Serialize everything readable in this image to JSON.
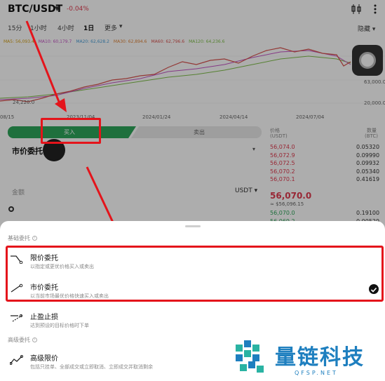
{
  "header": {
    "pair": "BTC/USDT",
    "change": "-0.04%",
    "icons": [
      "candlestick-icon",
      "more-icon"
    ]
  },
  "intervals": {
    "items": [
      "15分",
      "1小时",
      "4小时",
      "1日",
      "更多"
    ],
    "active": "1日",
    "hide_label": "隐藏"
  },
  "ma_indicators": [
    {
      "label": "MA5: 56,093.4",
      "color": "#d4a017"
    },
    {
      "label": "MA10: 60,179.7",
      "color": "#c455c4"
    },
    {
      "label": "MA20: 62,628.2",
      "color": "#4a9fd8"
    },
    {
      "label": "MA30: 62,894.6",
      "color": "#e0853a"
    },
    {
      "label": "MA60: 62,796.6",
      "color": "#d9534f"
    },
    {
      "label": "MA120: 64,236.6",
      "color": "#7fbf4a"
    }
  ],
  "chart": {
    "price_high": "63,000.0",
    "price_low": "20,000.0",
    "min_label": "24,220.0",
    "x_labels": [
      "08/15",
      "2023/11/04",
      "2024/01/24",
      "2024/04/14",
      "2024/07/04"
    ]
  },
  "trade_tabs": {
    "buy": "买入",
    "sell": "卖出"
  },
  "order_form": {
    "order_type": "市价委托",
    "amount_label": "金额",
    "amount_unit": "USDT"
  },
  "order_book": {
    "price_header": "价格",
    "price_unit": "(USDT)",
    "qty_header": "数量",
    "qty_unit": "(BTC)",
    "asks": [
      {
        "price": "56,074.0",
        "qty": "0.05320"
      },
      {
        "price": "56,072.9",
        "qty": "0.09990"
      },
      {
        "price": "56,072.5",
        "qty": "0.09932"
      },
      {
        "price": "56,070.2",
        "qty": "0.05340"
      },
      {
        "price": "56,070.1",
        "qty": "0.41619"
      }
    ],
    "last_price": "56,070.0",
    "last_price_sub": "≈ $56,096.15",
    "bids": [
      {
        "price": "56,070.0",
        "qty": "0.19100"
      },
      {
        "price": "56,069.2",
        "qty": "0.00529"
      }
    ]
  },
  "sheet": {
    "basic_section": "基础委托",
    "options": [
      {
        "title": "限价委托",
        "desc": "以指定或更优价格买入或卖出",
        "icon": "limit-order-icon"
      },
      {
        "title": "市价委托",
        "desc": "以当前市场最优价格快速买入或卖出",
        "icon": "market-order-icon",
        "selected": true
      },
      {
        "title": "止盈止损",
        "desc": "达到预设的目标价格时下单",
        "icon": "tp-sl-icon"
      }
    ],
    "advanced_section": "高级委托",
    "advanced_options": [
      {
        "title": "高级限价",
        "desc": "包括只挂单、全部成交或立即取消、立即成交并取消剩余",
        "icon": "advanced-limit-icon"
      }
    ]
  },
  "watermark": {
    "text": "量链科技",
    "sub": "QFSP.NET"
  },
  "colors": {
    "buy": "#2ea55a",
    "sell": "#e03a4e",
    "annotation": "#e4141b",
    "watermark": "#1e7fbf"
  }
}
